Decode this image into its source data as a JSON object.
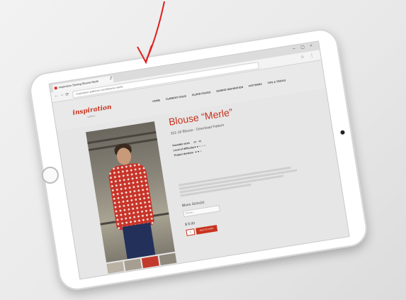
{
  "browser": {
    "tab_title": "Inspiration Sewing Blouse Merle",
    "url": "inspiration-patterns.com/blouse-merle"
  },
  "site": {
    "logo": "inspiration",
    "logo_sub": "patterns",
    "nav": [
      "HOME",
      "CURRENT ISSUE",
      "OLDER ISSUES",
      "SEWING INSPIRATION",
      "PATTERNS",
      "TIPS & TRICKS"
    ]
  },
  "product": {
    "title": "Blouse “Merle”",
    "subtitle": "321-18 Blouse - Download Pattern",
    "meta": [
      {
        "label": "Possible sizes",
        "value": "36 - 46"
      },
      {
        "label": "Level of difficulty",
        "value": "●●○○○"
      },
      {
        "label": "Project duration",
        "value": "●●○"
      }
    ],
    "variant_label": "Blues Sizes(s)",
    "variant_placeholder": "Choose...",
    "price": "$ 5.00",
    "qty": "1",
    "add_to_cart": "ADD TO CART"
  },
  "colors": {
    "accent": "#c8331f",
    "annotation": "#e02020"
  },
  "icons": [
    "back-icon",
    "forward-icon",
    "reload-icon",
    "bookmark-icon",
    "menu-icon"
  ]
}
